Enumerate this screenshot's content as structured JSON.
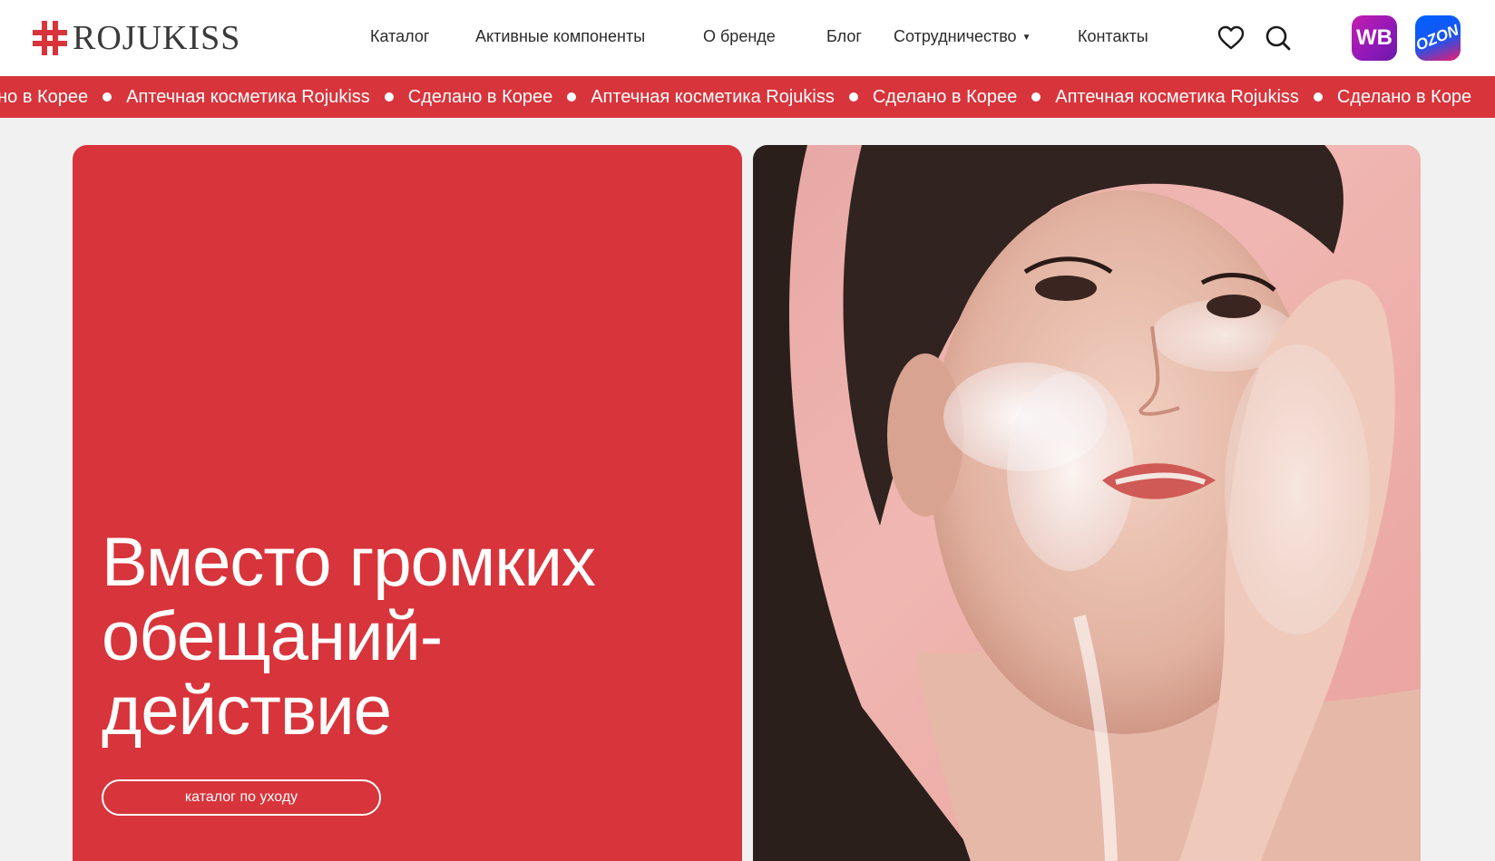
{
  "brand": {
    "name": "ROJUKISS",
    "accent": "#d8343b"
  },
  "nav": {
    "items": [
      {
        "label": "Каталог"
      },
      {
        "label": "Активные компоненты"
      },
      {
        "label": "О бренде"
      },
      {
        "label": "Блог"
      },
      {
        "label": "Сотрудничество"
      },
      {
        "label": "Контакты"
      }
    ],
    "icons": [
      "heart-icon",
      "search-icon"
    ],
    "marketplaces": [
      {
        "label": "WB",
        "icon": "wildberries-icon"
      },
      {
        "label": "OZON",
        "icon": "ozon-icon"
      }
    ]
  },
  "ticker": {
    "items": [
      "ано в Корее",
      "Аптечная косметика Rojukiss",
      "Сделано в Корее",
      "Аптечная косметика Rojukiss",
      "Сделано в Корее",
      "Аптечная косметика Rojukiss",
      "Сделано в Коре"
    ]
  },
  "hero": {
    "title_line1": "Вместо громких",
    "title_line2": "обещаний-",
    "title_line3": "действие",
    "button_label": "каталог по уходу",
    "image": "woman-washing-face-with-foam-photo"
  }
}
